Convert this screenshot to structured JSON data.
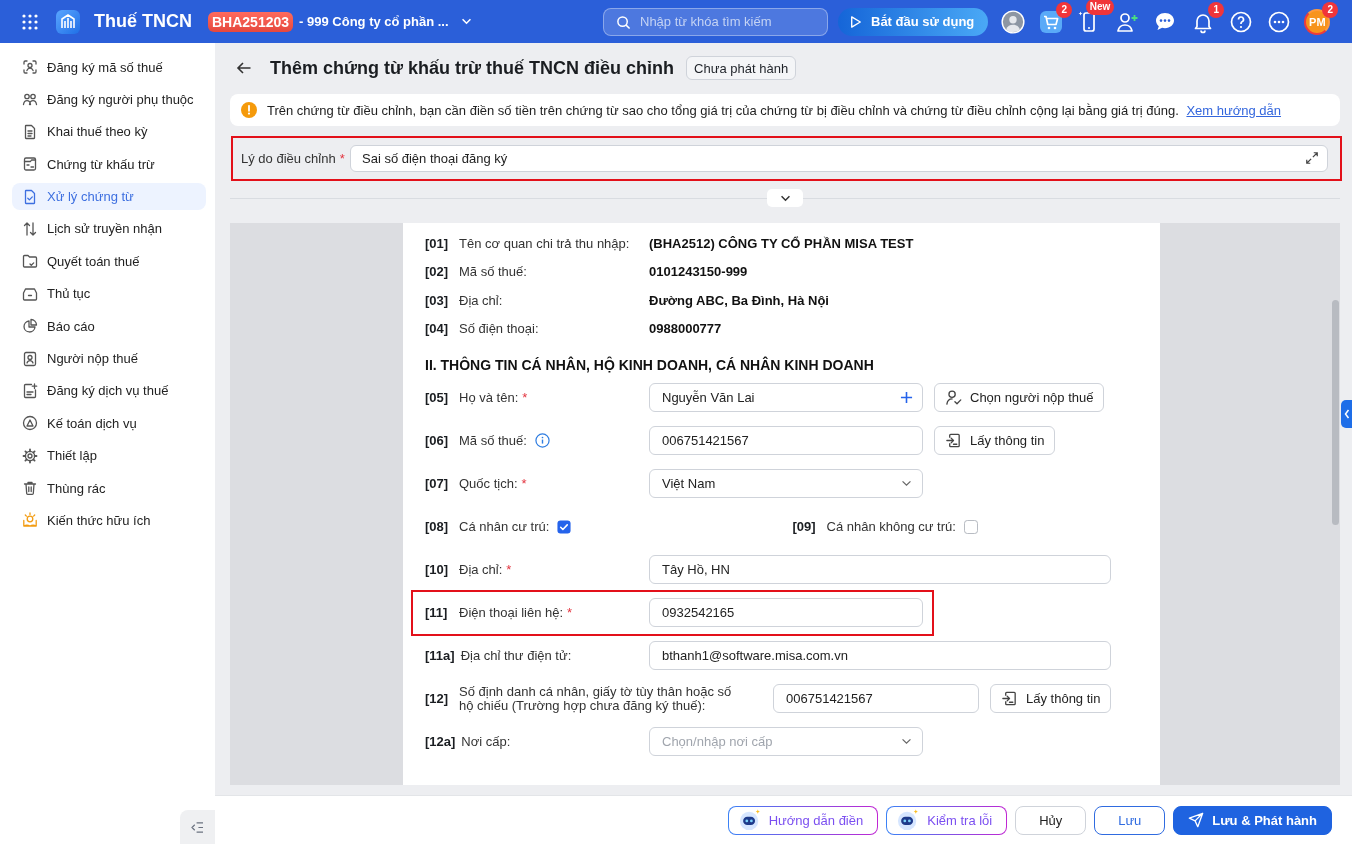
{
  "topbar": {
    "app_name": "Thuế TNCN",
    "org_code": "BHA251203",
    "org_name": "- 999 Công ty cổ phần ...",
    "search": {
      "placeholder": "Nhập từ khóa tìm kiếm"
    },
    "start_button": "Bắt đầu sử dụng",
    "icons": [
      {
        "kind": "avatar"
      },
      {
        "kind": "cart",
        "badge": "2"
      },
      {
        "kind": "phone",
        "badge": "New"
      },
      {
        "kind": "user-add"
      },
      {
        "kind": "chat"
      },
      {
        "kind": "bell",
        "badge": "1"
      },
      {
        "kind": "help"
      },
      {
        "kind": "more"
      },
      {
        "kind": "profile",
        "initials": "PM",
        "badge": "2"
      }
    ]
  },
  "sidebar": {
    "items": [
      {
        "label": "Đăng ký mã số thuế",
        "selected": false
      },
      {
        "label": "Đăng ký người phụ thuộc",
        "selected": false
      },
      {
        "label": "Khai thuế theo kỳ",
        "selected": false
      },
      {
        "label": "Chứng từ khấu trừ",
        "selected": false
      },
      {
        "label": "Xử lý chứng từ",
        "selected": true
      },
      {
        "label": "Lịch sử truyền nhận",
        "selected": false
      },
      {
        "label": "Quyết toán thuế",
        "selected": false
      },
      {
        "label": "Thủ tục",
        "selected": false
      },
      {
        "label": "Báo cáo",
        "selected": false
      },
      {
        "label": "Người nộp thuế",
        "selected": false
      },
      {
        "label": "Đăng ký dịch vụ thuế",
        "selected": false
      },
      {
        "label": "Kế toán dịch vụ",
        "selected": false
      },
      {
        "label": "Thiết lập",
        "selected": false
      },
      {
        "label": "Thùng rác",
        "selected": false
      },
      {
        "label": "Kiến thức hữu ích",
        "selected": false
      }
    ]
  },
  "page": {
    "title": "Thêm chứng từ khấu trừ thuế TNCN điều chỉnh",
    "status": "Chưa phát hành"
  },
  "notice": {
    "text": "Trên chứng từ điều chỉnh, bạn cần điền số tiền trên chứng từ sao cho tổng giá trị của chứng từ bị điều chỉnh và chứng từ điều chỉnh cộng lại bằng giá trị đúng.",
    "link": "Xem hướng dẫn"
  },
  "reason": {
    "label": "Lý do điều chỉnh",
    "required_mark": "*",
    "value": "Sai số điện thoại đăng ký",
    "highlighted": true
  },
  "form": {
    "payer_rows": [
      {
        "code": "[01]",
        "label": "Tên cơ quan chi trả thu nhập:",
        "value": "(BHA2512) CÔNG TY CỔ PHẦN MISA TEST"
      },
      {
        "code": "[02]",
        "label": "Mã số thuế:",
        "value": "0101243150-999"
      },
      {
        "code": "[03]",
        "label": "Địa chỉ:",
        "value": "Đường ABC, Ba Đình, Hà Nội"
      },
      {
        "code": "[04]",
        "label": "Số điện thoại:",
        "value": "0988000777"
      }
    ],
    "section_title": "II. THÔNG TIN CÁ NHÂN, HỘ KINH DOANH, CÁ NHÂN KINH DOANH",
    "fields": [
      {
        "kind": "input",
        "code": "[05]",
        "label": "Họ và tên:",
        "required_mark": "*",
        "value": "Nguyễn Văn Lai",
        "add_icon": true,
        "button": {
          "kind": "pick",
          "label": "Chọn người nộp thuế"
        }
      },
      {
        "kind": "input",
        "code": "[06]",
        "label": "Mã số thuế:",
        "info": true,
        "value": "006751421567",
        "button": {
          "kind": "fetch",
          "label": "Lấy thông tin"
        }
      },
      {
        "kind": "select",
        "code": "[07]",
        "label": "Quốc tịch:",
        "required_mark": "*",
        "value": "Việt Nam"
      },
      {
        "kind": "checks",
        "items": [
          {
            "code": "[08]",
            "label": "Cá nhân cư trú:",
            "checked": true
          },
          {
            "code": "[09]",
            "label": "Cá nhân không cư trú:",
            "checked": false
          }
        ]
      },
      {
        "kind": "input",
        "code": "[10]",
        "label": "Địa chỉ:",
        "required_mark": "*",
        "value": "Tây Hồ, HN"
      },
      {
        "kind": "input",
        "code": "[11]",
        "label": "Điện thoại liên hệ:",
        "required_mark": "*",
        "value": "0932542165",
        "highlighted": true
      },
      {
        "kind": "input",
        "code": "[11a]",
        "label": "Địa chỉ thư điện tử:",
        "value": "bthanh1@software.misa.com.vn"
      },
      {
        "kind": "input",
        "code": "[12]",
        "label": "Số định danh cá nhân, giấy tờ tùy thân hoặc số hộ chiếu (Trường hợp chưa đăng ký thuế):",
        "value": "006751421567",
        "button": {
          "kind": "fetch",
          "label": "Lấy thông tin"
        }
      },
      {
        "kind": "select",
        "code": "[12a]",
        "label": "Nơi cấp:",
        "placeholder": "Chọn/nhập nơi cấp"
      }
    ]
  },
  "actions": [
    {
      "kind": "assistant",
      "label": "Hướng dẫn điền"
    },
    {
      "kind": "assistant",
      "label": "Kiểm tra lỗi"
    },
    {
      "kind": "plain",
      "label": "Hủy"
    },
    {
      "kind": "outline",
      "label": "Lưu"
    },
    {
      "kind": "primary",
      "label": "Lưu & Phát hành"
    }
  ]
}
